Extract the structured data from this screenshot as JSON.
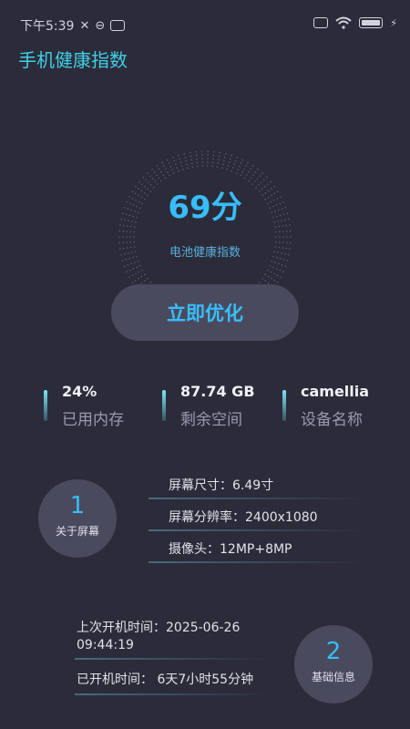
{
  "status": {
    "time": "下午5:39"
  },
  "app": {
    "title": "手机健康指数"
  },
  "health": {
    "score": "69分",
    "label": "电池健康指数",
    "score_value": 69
  },
  "actions": {
    "optimize": "立即优化"
  },
  "stats": [
    {
      "value": "24%",
      "label": "已用内存"
    },
    {
      "value": "87.74 GB",
      "label": "剩余空间"
    },
    {
      "value": "camellia",
      "label": "设备名称"
    }
  ],
  "screen": {
    "number": "1",
    "caption": "关于屏幕",
    "rows": [
      "屏幕尺寸：6.49寸",
      "屏幕分辨率：2400x1080",
      "摄像头：12MP+8MP"
    ]
  },
  "basic": {
    "number": "2",
    "caption": "基础信息",
    "rows": [
      "上次开机时间：2025-06-26 09:44:19",
      "已开机时间：  6天7小时55分钟"
    ]
  }
}
